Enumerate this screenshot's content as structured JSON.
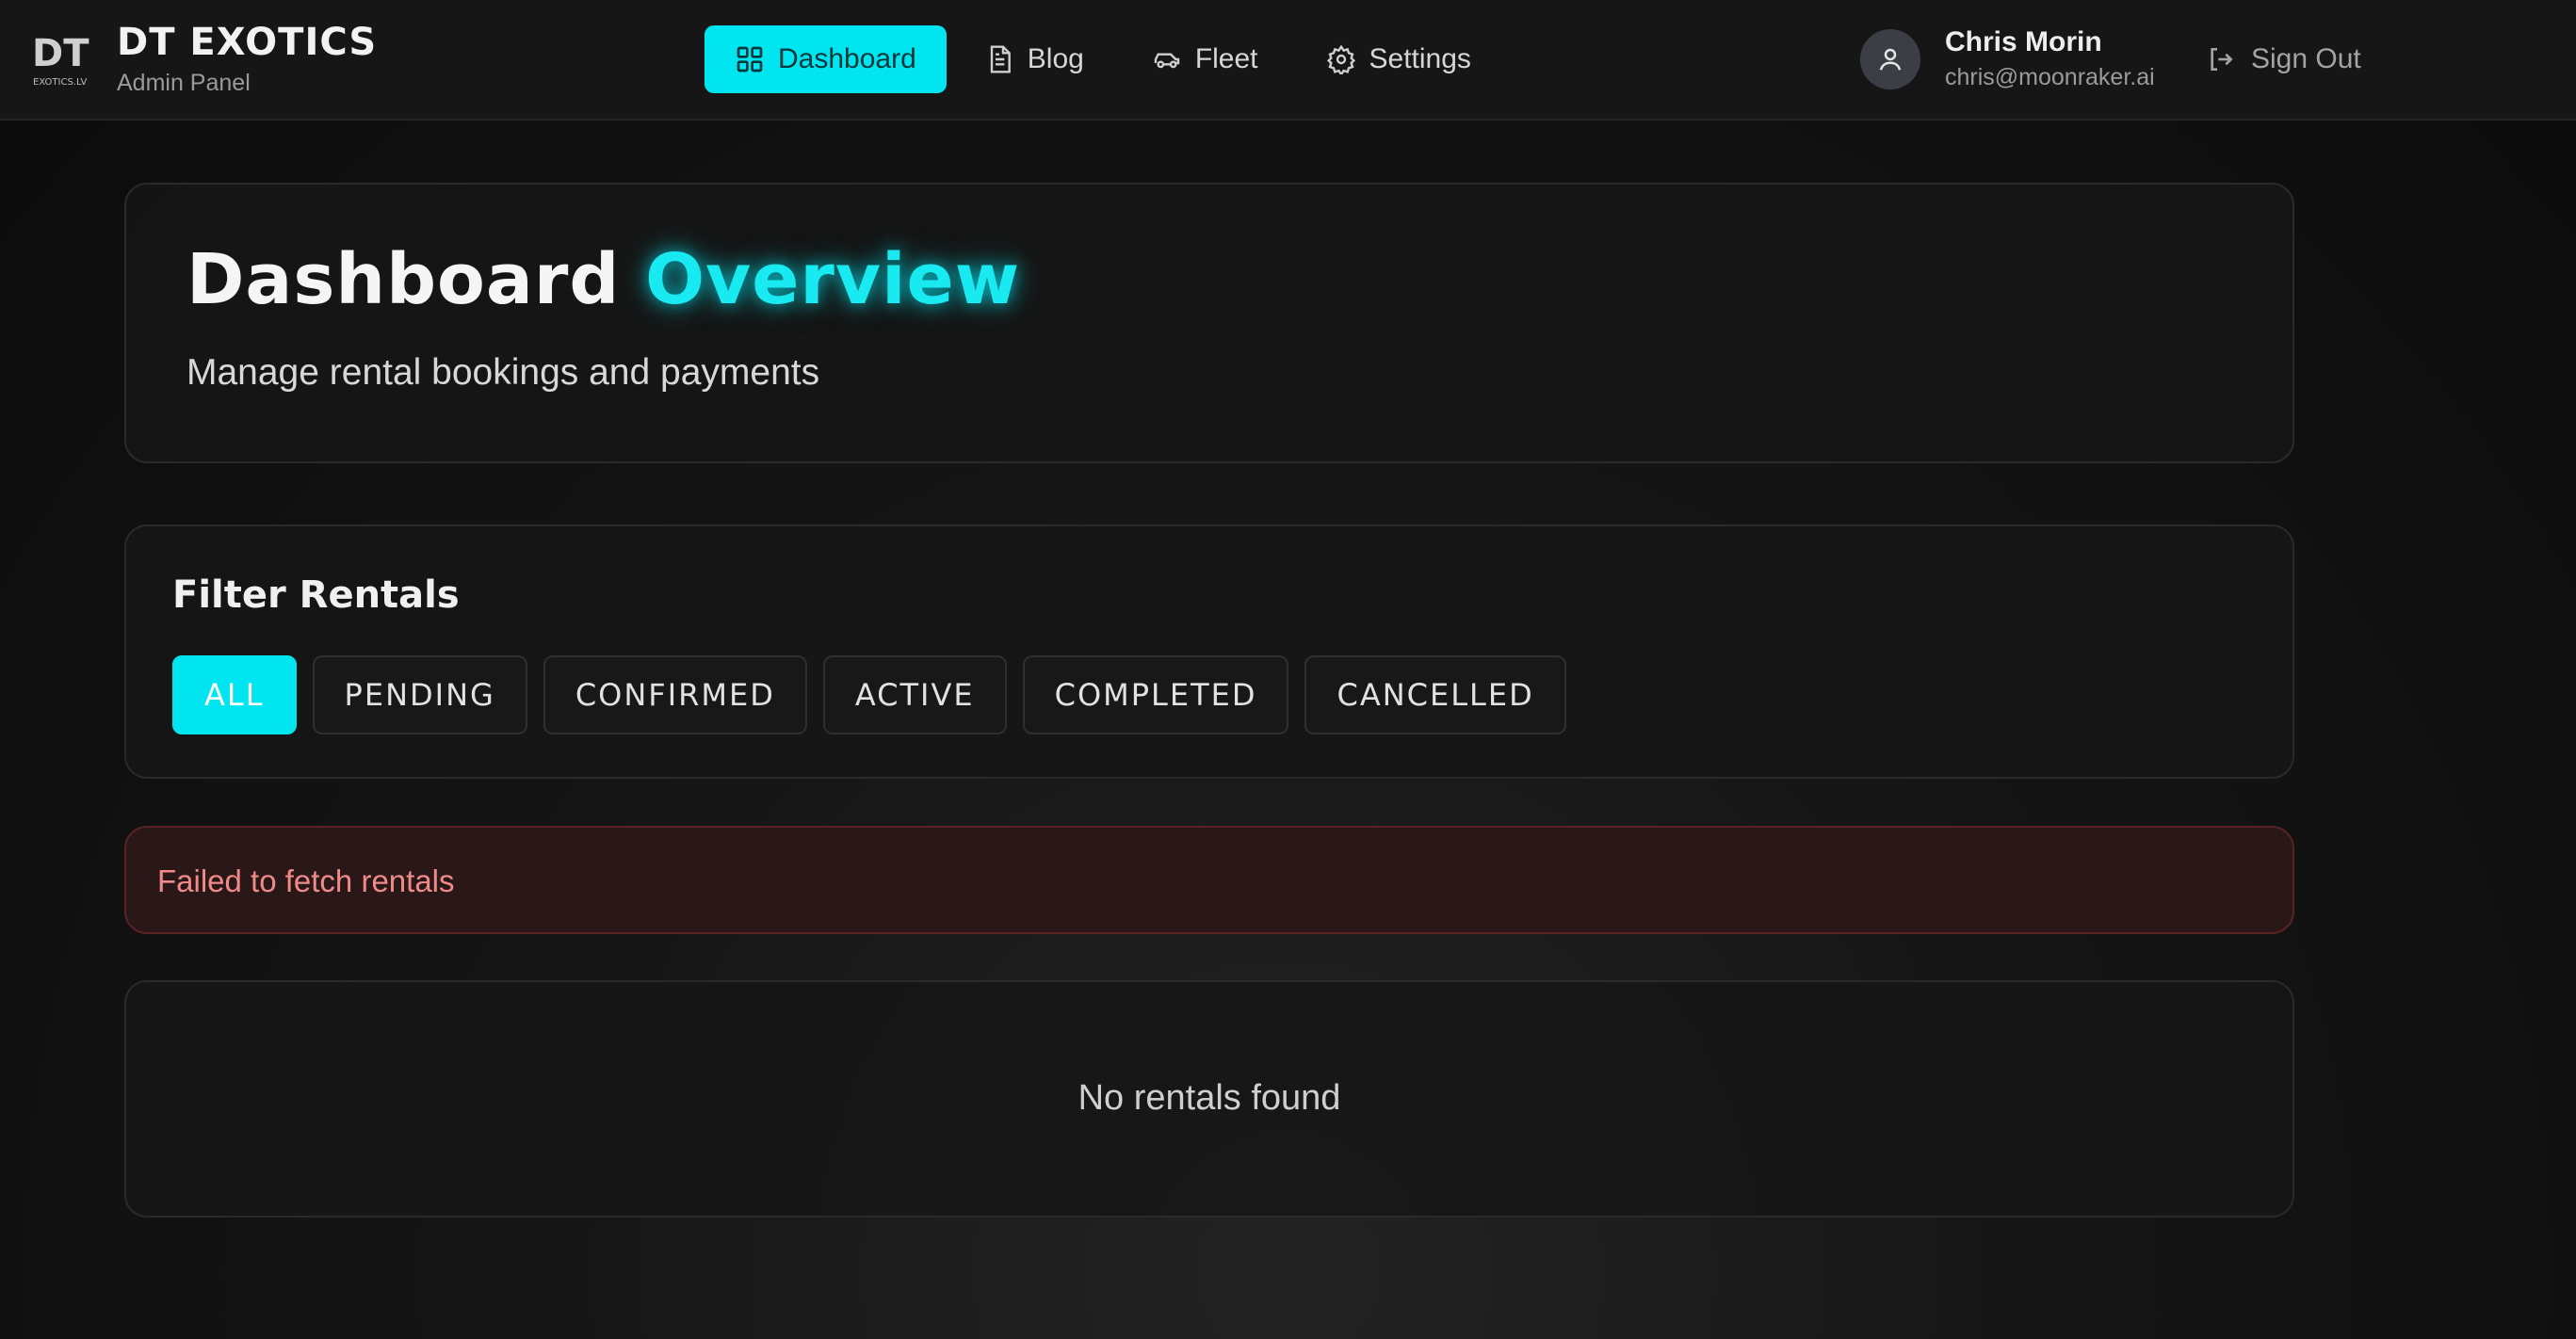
{
  "brand": {
    "logo_text": "DT",
    "logo_sub": "EXOTICS.LV",
    "name": "DT EXOTICS",
    "subtitle": "Admin Panel"
  },
  "nav": {
    "items": [
      {
        "label": "Dashboard",
        "icon": "dashboard-grid-icon",
        "active": true
      },
      {
        "label": "Blog",
        "icon": "document-icon",
        "active": false
      },
      {
        "label": "Fleet",
        "icon": "car-icon",
        "active": false
      },
      {
        "label": "Settings",
        "icon": "gear-icon",
        "active": false
      }
    ]
  },
  "user": {
    "name": "Chris Morin",
    "email": "chris@moonraker.ai",
    "avatar_icon": "user-icon"
  },
  "signout": {
    "label": "Sign Out",
    "icon": "sign-out-icon"
  },
  "overview": {
    "title_main": "Dashboard",
    "title_accent": "Overview",
    "subtitle": "Manage rental bookings and payments"
  },
  "filter": {
    "title": "Filter Rentals",
    "options": [
      "ALL",
      "PENDING",
      "CONFIRMED",
      "ACTIVE",
      "COMPLETED",
      "CANCELLED"
    ],
    "selected": "ALL"
  },
  "alert": {
    "message": "Failed to fetch rentals"
  },
  "rentals": {
    "empty_message": "No rentals found"
  },
  "colors": {
    "accent": "#00e5f0",
    "error_text": "#f08a8a",
    "error_bg": "#2a1818",
    "background": "#0d0d0d"
  }
}
